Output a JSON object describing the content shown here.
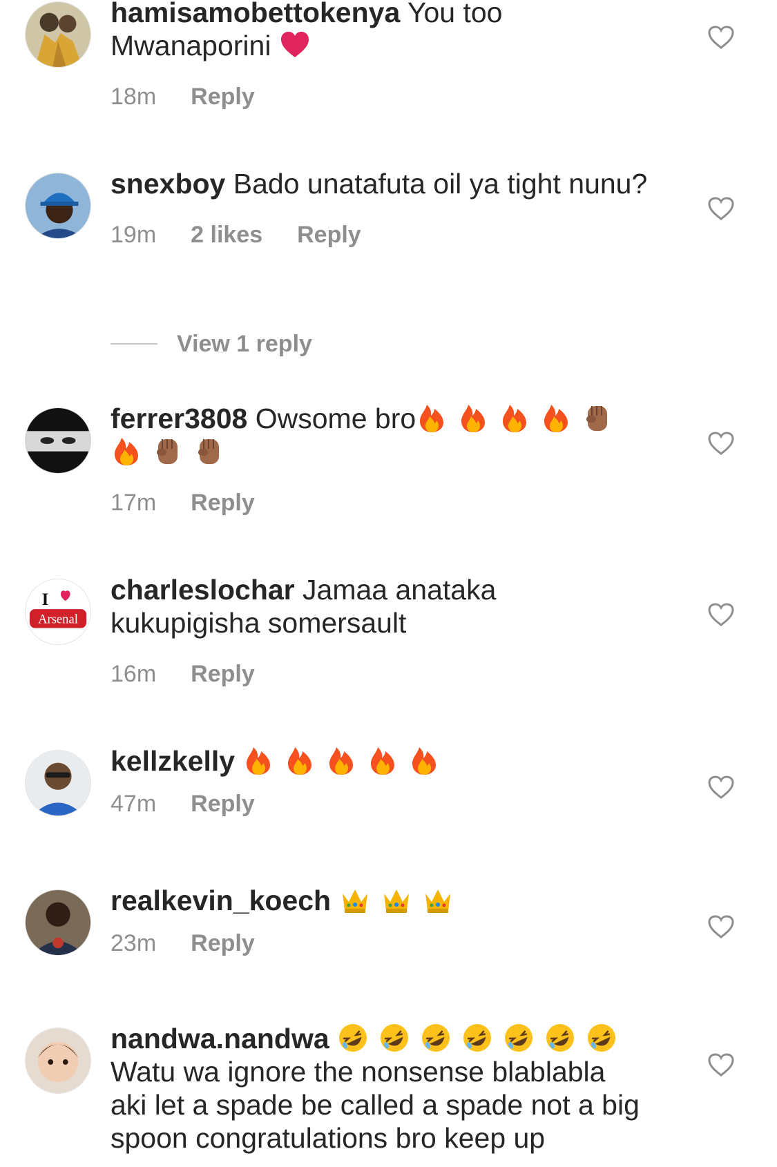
{
  "comments": [
    {
      "username": "hamisamobettokenya",
      "text": "You too Mwanaporini",
      "emoji_sequence": [
        "red-heart"
      ],
      "time": "18m",
      "likes": "",
      "reply_label": "Reply"
    },
    {
      "username": "snexboy",
      "text": "Bado unatafuta oil ya tight nunu?",
      "emoji_sequence": [],
      "time": "19m",
      "likes": "2 likes",
      "reply_label": "Reply"
    },
    {
      "username": "ferrer3808",
      "text": "Owsome bro",
      "emoji_sequence": [
        "fire",
        "fire",
        "fire",
        "fire",
        "raised-fist",
        "fire",
        "raised-fist",
        "raised-fist"
      ],
      "time": "17m",
      "likes": "",
      "reply_label": "Reply"
    },
    {
      "username": "charleslochar",
      "text": "Jamaa anataka kukupigisha somersault",
      "emoji_sequence": [],
      "time": "16m",
      "likes": "",
      "reply_label": "Reply"
    },
    {
      "username": "kellzkelly",
      "text": "",
      "emoji_sequence": [
        "fire",
        "fire",
        "fire",
        "fire",
        "fire"
      ],
      "time": "47m",
      "likes": "",
      "reply_label": "Reply"
    },
    {
      "username": "realkevin_koech",
      "text": "",
      "emoji_sequence": [
        "crown",
        "crown",
        "crown"
      ],
      "time": "23m",
      "likes": "",
      "reply_label": "Reply"
    },
    {
      "username": "nandwa.nandwa",
      "text": "Watu wa ignore the nonsense blablabla aki let a spade be called a spade not a big spoon congratulations bro keep up",
      "emoji_sequence": [
        "rofl",
        "rofl",
        "rofl",
        "rofl",
        "rofl",
        "rofl",
        "rofl"
      ],
      "time": "",
      "likes": "",
      "reply_label": ""
    }
  ],
  "view_replies": {
    "label": "View 1 reply"
  },
  "avatar_badge": {
    "text1": "I",
    "text2": "Arsenal"
  },
  "icons": {
    "like": "heart-outline-icon"
  },
  "colors": {
    "text": "#262626",
    "meta": "#8e8e8e",
    "divider": "#c7c7c7",
    "fire": "#f4511e",
    "heart": "#e0245e"
  }
}
